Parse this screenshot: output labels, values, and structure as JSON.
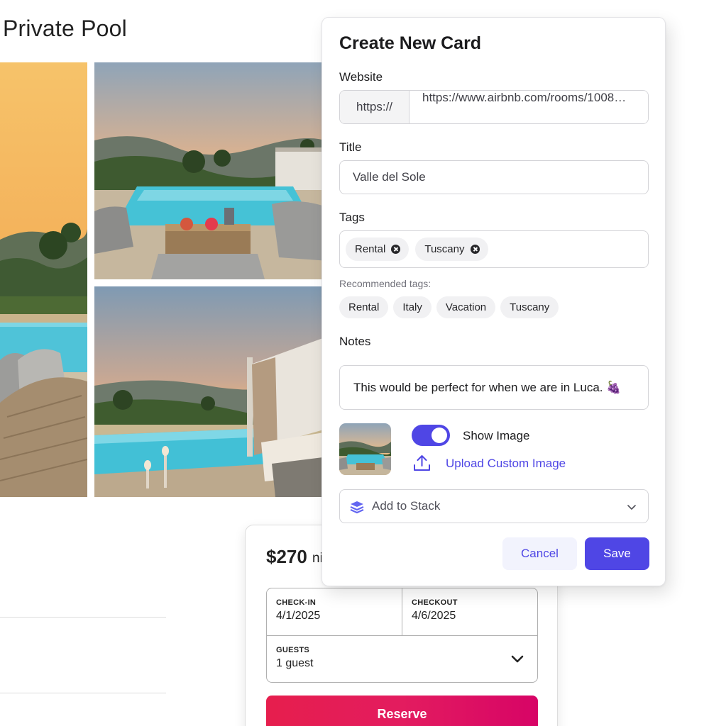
{
  "listing": {
    "title": "Private Pool",
    "photos": [
      {
        "name": "pool-terrace-sunset"
      },
      {
        "name": "pool-lounge-seating"
      },
      {
        "name": "pool-cabana-candles"
      }
    ]
  },
  "booking": {
    "price": "$270",
    "price_unit": "ni",
    "checkin_label": "CHECK-IN",
    "checkin_value": "4/1/2025",
    "checkout_label": "CHECKOUT",
    "checkout_value": "4/6/2025",
    "guests_label": "GUESTS",
    "guests_value": "1 guest",
    "reserve_label": "Reserve",
    "reserve_color": "#e31c5f"
  },
  "dialog": {
    "title": "Create New Card",
    "website_label": "Website",
    "url_prefix": "https://",
    "url_value": "https://www.airbnb.com/rooms/1008…",
    "title_label": "Title",
    "title_value": "Valle del Sole",
    "tags_label": "Tags",
    "tags": [
      {
        "label": "Rental"
      },
      {
        "label": "Tuscany"
      }
    ],
    "recommended_label": "Recommended tags:",
    "recommended": [
      {
        "label": "Rental"
      },
      {
        "label": "Italy"
      },
      {
        "label": "Vacation"
      },
      {
        "label": "Tuscany"
      }
    ],
    "notes_label": "Notes",
    "notes_value": "This would be perfect for when we are in Luca. 🍇",
    "show_image_label": "Show Image",
    "show_image_on": true,
    "upload_label": "Upload Custom Image",
    "stack_placeholder": "Add to Stack",
    "cancel_label": "Cancel",
    "save_label": "Save",
    "accent_color": "#4f46e5"
  }
}
